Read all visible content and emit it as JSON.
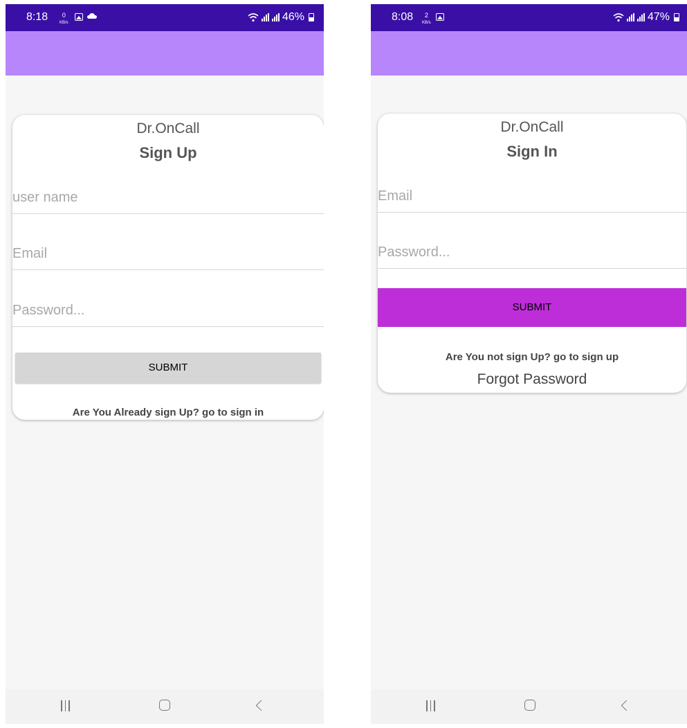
{
  "colors": {
    "status_bar": "#3a0fa6",
    "app_bar": "#b886fb",
    "background": "#f6f6f6",
    "signup_submit": "#d6d6d6",
    "signin_submit": "#bd2ed8"
  },
  "signup_screen": {
    "status": {
      "time": "8:18",
      "net_speed_value": "0",
      "net_speed_unit": "KB/s",
      "battery": "46%",
      "icons": [
        "gallery-icon",
        "cloud-icon",
        "wifi-icon",
        "signal-icon",
        "battery-icon"
      ]
    },
    "brand": "Dr.OnCall",
    "heading": "Sign Up",
    "username_placeholder": "user name",
    "email_placeholder": "Email",
    "password_placeholder": "Password...",
    "submit_label": "SUBMIT",
    "signin_link": "Are You Already sign Up? go to sign in",
    "nav_icons": [
      "recent-apps-icon",
      "home-icon",
      "back-icon"
    ]
  },
  "signin_screen": {
    "status": {
      "time": "8:08",
      "net_speed_value": "2",
      "net_speed_unit": "KB/s",
      "battery": "47%",
      "icons": [
        "gallery-icon",
        "wifi-icon",
        "signal-icon",
        "battery-icon"
      ]
    },
    "brand": "Dr.OnCall",
    "heading": "Sign In",
    "email_placeholder": "Email",
    "password_placeholder": "Password...",
    "submit_label": "SUBMIT",
    "signup_link": "Are You not sign Up? go to sign up",
    "forgot_password": "Forgot Password",
    "nav_icons": [
      "recent-apps-icon",
      "home-icon",
      "back-icon"
    ]
  }
}
